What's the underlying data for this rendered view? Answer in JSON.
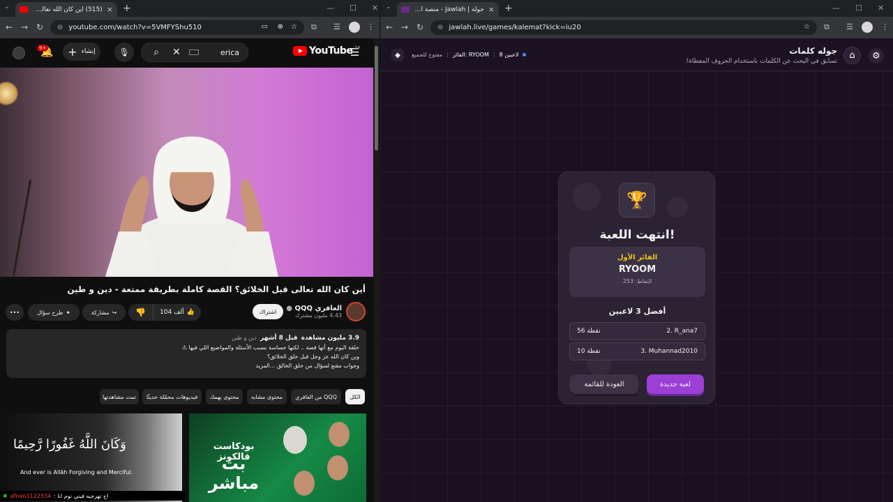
{
  "left": {
    "tab_title": "(515) أين كان الله تعالى قبل ا...",
    "url": "youtube.com/watch?v=5VMFYShu510",
    "youtube": {
      "logo": "YouTube",
      "country": "SA",
      "search_query": "erica",
      "create_label": "إنشاء",
      "notif_badge": "9+",
      "video_title": "أين كان الله تعالى قبل الخلائق؟ القصة كاملة بطريقة ممتعة - دين و طين",
      "channel_name": "الغافري QQQ",
      "subscribers": "4.43 مليون مشترك",
      "subscribe_label": "اشتراك",
      "likes": "104 ألف",
      "share_label": "مشاركة",
      "ask_label": "طرح سؤال",
      "desc_views": "3.9 مليون مشاهدة",
      "desc_age": "قبل 8 أشهر",
      "desc_tags": "دين و طين",
      "desc_line1": "حلقة اليوم مع أنها قصة .. لكنها حساسة بسبب الأسئلة والمواضيع اللي فيها ⚠",
      "desc_line2": "وين كان الله عز وجل قبل خلق الخلائق؟",
      "desc_line3": "وجواب مقنع لسؤال من خلق الخالق ...المزيد",
      "chips": [
        "الكل",
        "من الغافري QQQ",
        "محتوى مشابه",
        "محتوى يهمك",
        "فيديوهات محمّلة حديثًا",
        "تمت مشاهدتها"
      ],
      "thumb1_arabic": "وَكَانَ اللَّهُ غَفُورًا رَّحِيمًا",
      "thumb1_english": "And ever is Allāh Forgiving and Merciful.",
      "thumb2_line1": "بودكاست فالكونز",
      "thumb2_line2": "بث مباشر",
      "chat_user": "afnan1122334",
      "chat_text": ": اح تهرجيه فيني نوم انا"
    }
  },
  "right": {
    "tab_title": "جولة | Jawlah - منصة الألعاب الج...",
    "url": "jawlah.live/games/kalemat?kick=iu20",
    "game_title": "جوله كلمات",
    "game_subtitle": "تسابق في البحث عن الكلمات باستخدام الحروف المعطاة!",
    "players": "8 لاعبين",
    "winner_tag": "الفائز: RYOOM",
    "open_tag": "مفتوح للجميع",
    "card": {
      "heading": "انتهت اللعبة!",
      "first_label": "الفائز الأول",
      "first_name": "RYOOM",
      "first_points": "النقاط: 253",
      "top_label": "أفضل 3 لاعبين",
      "rows": [
        {
          "name": "2. R_ana7",
          "pts": "56 نقطة"
        },
        {
          "name": "3. Muhannad2010",
          "pts": "10 نقطة"
        }
      ],
      "new_game": "لعبة جديدة",
      "back_list": "العودة للقائمة"
    }
  }
}
